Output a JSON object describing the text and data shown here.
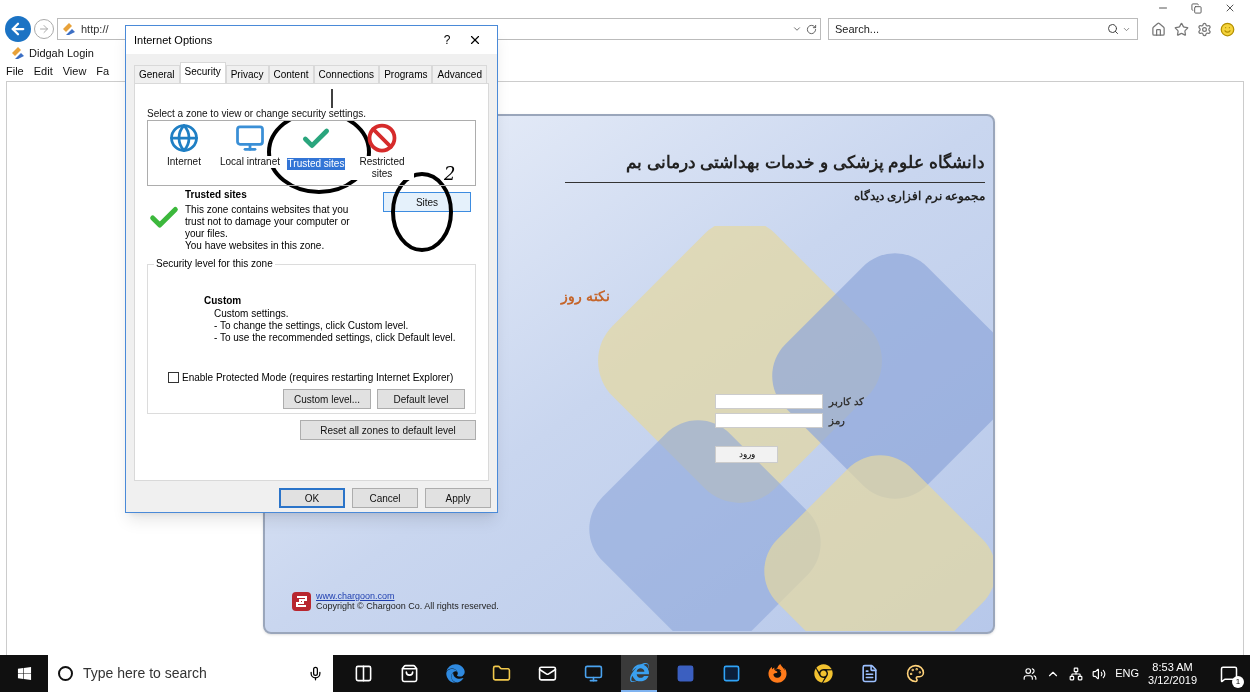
{
  "browser": {
    "address": "http://",
    "search_placeholder": "Search...",
    "tab_title": "Didgah Login",
    "menu": [
      "File",
      "Edit",
      "View",
      "Fa"
    ]
  },
  "login": {
    "title": "دانشگاه علوم پزشکی و خدمات بهداشتی درمانی بم",
    "subtitle": "مجموعه نرم افزاری دیدگاه",
    "tip_title": "نکته روز",
    "fields": [
      {
        "label": "کد کاربر"
      },
      {
        "label": "رمز"
      }
    ],
    "submit": "ورود",
    "link": "www.chargoon.com",
    "copyright": "Copyright © Chargoon Co. All rights reserved."
  },
  "dialog": {
    "title": "Internet Options",
    "help": "?",
    "tabs": [
      {
        "label": "General",
        "selected": false
      },
      {
        "label": "Security",
        "selected": true
      },
      {
        "label": "Privacy",
        "selected": false
      },
      {
        "label": "Content",
        "selected": false
      },
      {
        "label": "Connections",
        "selected": false
      },
      {
        "label": "Programs",
        "selected": false
      },
      {
        "label": "Advanced",
        "selected": false
      }
    ],
    "zone_prompt": "Select a zone to view or change security settings.",
    "zones": [
      {
        "kind": "globe",
        "label": "Internet",
        "selected": false
      },
      {
        "kind": "intranet",
        "label": "Local intranet",
        "selected": false
      },
      {
        "kind": "trusted",
        "label": "Trusted sites",
        "selected": true
      },
      {
        "kind": "restricted",
        "label": "Restricted sites",
        "selected": false
      }
    ],
    "zone_name": "Trusted sites",
    "zone_description": "This zone contains websites that you trust not to damage your computer or your files.",
    "zone_note": "You have websites in this zone.",
    "sites_button": "Sites",
    "level_group": "Security level for this zone",
    "level_name": "Custom",
    "level_lines": [
      "Custom settings.",
      "- To change the settings, click Custom level.",
      "- To use the recommended settings, click Default level."
    ],
    "protected_mode": {
      "label": "Enable Protected Mode (requires restarting Internet Explorer)",
      "checked": false
    },
    "level_buttons": [
      "Custom level...",
      "Default level"
    ],
    "reset_button": "Reset all zones to default level",
    "footer_buttons": [
      {
        "label": "OK",
        "default": true
      },
      {
        "label": "Cancel",
        "default": false
      },
      {
        "label": "Apply",
        "default": false
      }
    ]
  },
  "annotation": {
    "mark": "2"
  },
  "taskbar": {
    "search_placeholder": "Type here to search",
    "apps": [
      {
        "kind": "taskview",
        "active": false
      },
      {
        "kind": "store",
        "active": false
      },
      {
        "kind": "edge",
        "active": false
      },
      {
        "kind": "folder",
        "active": false
      },
      {
        "kind": "mail",
        "active": false
      },
      {
        "kind": "remote",
        "active": false
      },
      {
        "kind": "ie",
        "active": true
      },
      {
        "kind": "visio",
        "active": false
      },
      {
        "kind": "photoshop",
        "active": false
      },
      {
        "kind": "firefox",
        "active": false
      },
      {
        "kind": "chrome",
        "active": false
      },
      {
        "kind": "word",
        "active": false
      },
      {
        "kind": "paint",
        "active": false
      }
    ],
    "language": "ENG",
    "time": "8:53 AM",
    "date": "3/12/2019",
    "notifications": "1"
  }
}
